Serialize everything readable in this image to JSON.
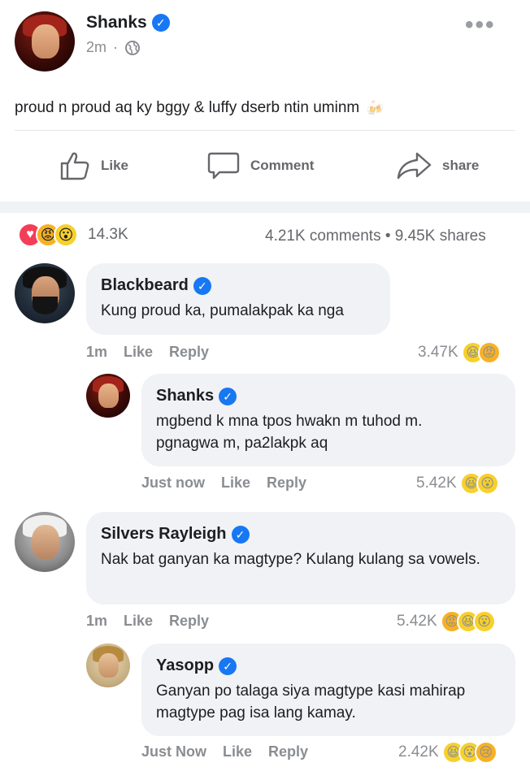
{
  "post": {
    "author": "Shanks",
    "time": "2m",
    "dot": "·",
    "privacy_icon": "globe-icon",
    "text": "proud n proud aq ky bggy & luffy dserb ntin uminm",
    "text_emoji": "🍻",
    "actions": {
      "like": "Like",
      "comment": "Comment",
      "share": "share"
    },
    "reaction_count": "14.3K",
    "comments_shares": "4.21K comments • 9.45K shares",
    "reactions": [
      "love",
      "angry",
      "wow"
    ]
  },
  "comments": [
    {
      "author": "Blackbeard",
      "text": "Kung proud ka, pumalakpak ka nga",
      "time": "1m",
      "like": "Like",
      "reply": "Reply",
      "count": "3.47K",
      "reactions": [
        "haha",
        "angry"
      ]
    },
    {
      "author": "Shanks",
      "text": "mgbend k mna tpos hwakn m tuhod m. pgnagwa m, pa2lakpk aq",
      "time": "Just now",
      "like": "Like",
      "reply": "Reply",
      "count": "5.42K",
      "reactions": [
        "haha",
        "wow"
      ]
    },
    {
      "author": "Silvers Rayleigh",
      "text": "Nak bat ganyan ka magtype? Kulang kulang sa vowels.",
      "time": "1m",
      "like": "Like",
      "reply": "Reply",
      "count": "5.42K",
      "reactions": [
        "angry",
        "haha",
        "wow"
      ]
    },
    {
      "author": "Yasopp",
      "text": "Ganyan po talaga siya magtype kasi mahirap magtype pag isa lang kamay.",
      "time": "Just Now",
      "like": "Like",
      "reply": "Reply",
      "count": "2.42K",
      "reactions": [
        "haha",
        "wow",
        "care"
      ]
    }
  ],
  "colors": {
    "verified": "#1877f2",
    "meta": "#8a8d91",
    "bubble": "#f0f2f5",
    "love": "#f33e58"
  }
}
